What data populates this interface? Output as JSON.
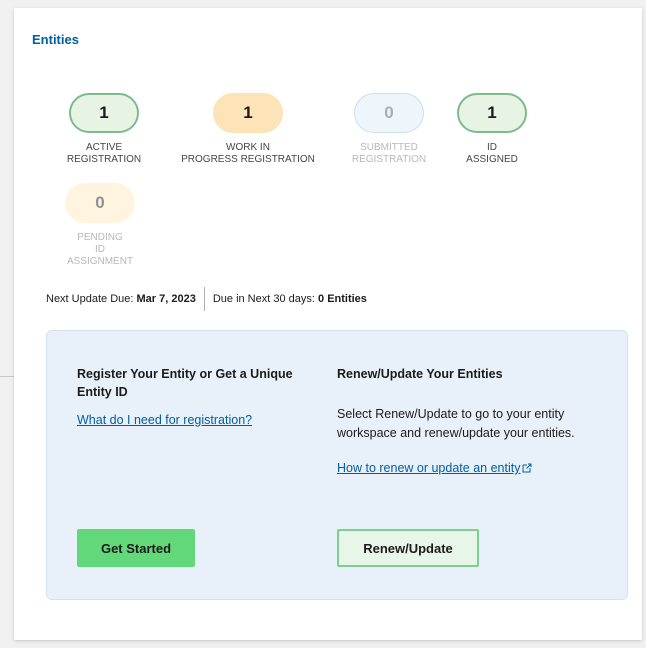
{
  "card": {
    "title": "Entities"
  },
  "stats": [
    {
      "value": "1",
      "label_lines": [
        "ACTIVE",
        "REGISTRATION"
      ]
    },
    {
      "value": "1",
      "label_lines": [
        "WORK IN",
        "PROGRESS REGISTRATION"
      ]
    },
    {
      "value": "0",
      "label_lines": [
        "SUBMITTED",
        "REGISTRATION"
      ]
    },
    {
      "value": "1",
      "label_lines": [
        "ID",
        "ASSIGNED"
      ]
    },
    {
      "value": "0",
      "label_lines": [
        "PENDING",
        "ID",
        "ASSIGNMENT"
      ]
    }
  ],
  "update": {
    "next_due_label": "Next Update Due:",
    "next_due_value": "Mar 7, 2023",
    "due_30_label": "Due in Next 30 days:",
    "due_30_value": "0 Entities"
  },
  "register": {
    "title": "Register Your Entity or Get a Unique Entity ID",
    "link": "What do I need for registration?",
    "button": "Get Started"
  },
  "renew": {
    "title": "Renew/Update Your Entities",
    "description": "Select Renew/Update to go to your entity workspace and renew/update your entities.",
    "link": "How to renew or update an entity",
    "link_icon": "external-link-icon",
    "button": "Renew/Update"
  },
  "colors": {
    "accent": "#005ea2",
    "green_button": "#62d87a",
    "panel_bg": "#e8f1f9"
  }
}
